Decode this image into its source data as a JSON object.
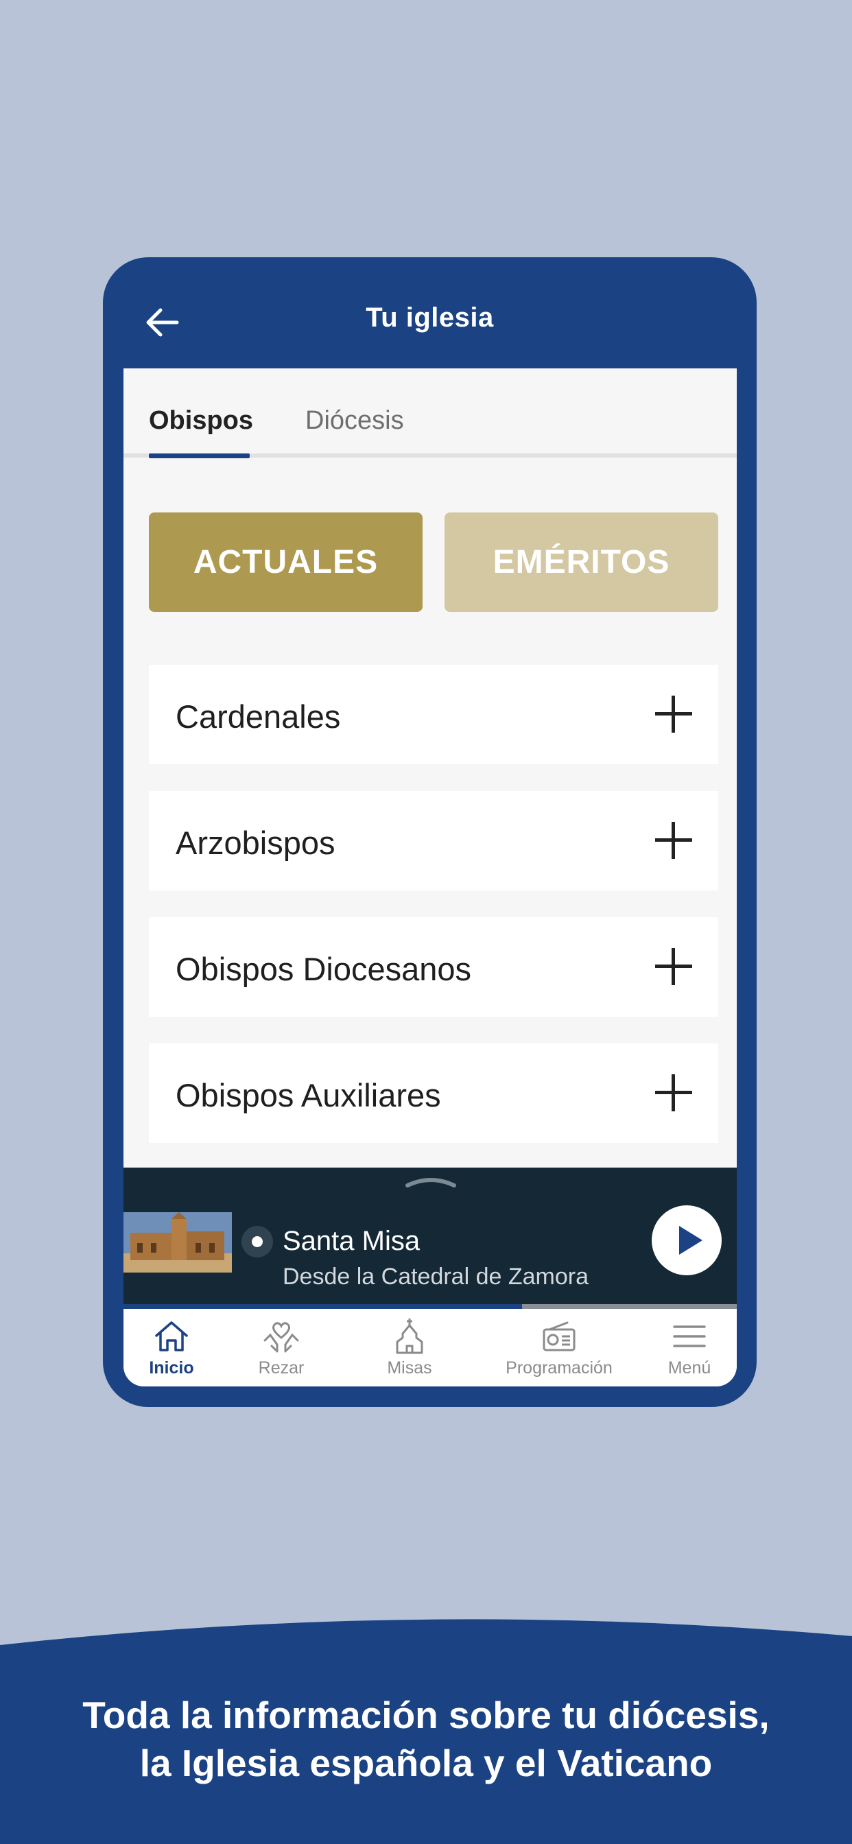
{
  "header": {
    "title": "Tu iglesia"
  },
  "tabs": [
    {
      "label": "Obispos",
      "active": true
    },
    {
      "label": "Diócesis",
      "active": false
    }
  ],
  "segments": {
    "actuales": "ACTUALES",
    "emeritos": "EMÉRITOS"
  },
  "list": [
    {
      "label": "Cardenales"
    },
    {
      "label": "Arzobispos"
    },
    {
      "label": "Obispos Diocesanos"
    },
    {
      "label": "Obispos Auxiliares"
    }
  ],
  "player": {
    "title": "Santa Misa",
    "subtitle": "Desde la Catedral de Zamora",
    "progress": 0.65
  },
  "nav": [
    {
      "label": "Inicio",
      "icon": "home-icon",
      "active": true
    },
    {
      "label": "Rezar",
      "icon": "praying-hands-heart-icon",
      "active": false
    },
    {
      "label": "Misas",
      "icon": "church-icon",
      "active": false
    },
    {
      "label": "Programación",
      "icon": "radio-icon",
      "active": false
    },
    {
      "label": "Menú",
      "icon": "hamburger-menu-icon",
      "active": false
    }
  ],
  "banner": {
    "line1": "Toda la información sobre tu diócesis,",
    "line2": "la Iglesia española y el Vaticano"
  },
  "colors": {
    "brand_blue": "#1b4283",
    "gold": "#ad9a50",
    "gold_light": "#d3c8a2",
    "background": "#b8c3d7",
    "player_bg": "#142836"
  }
}
